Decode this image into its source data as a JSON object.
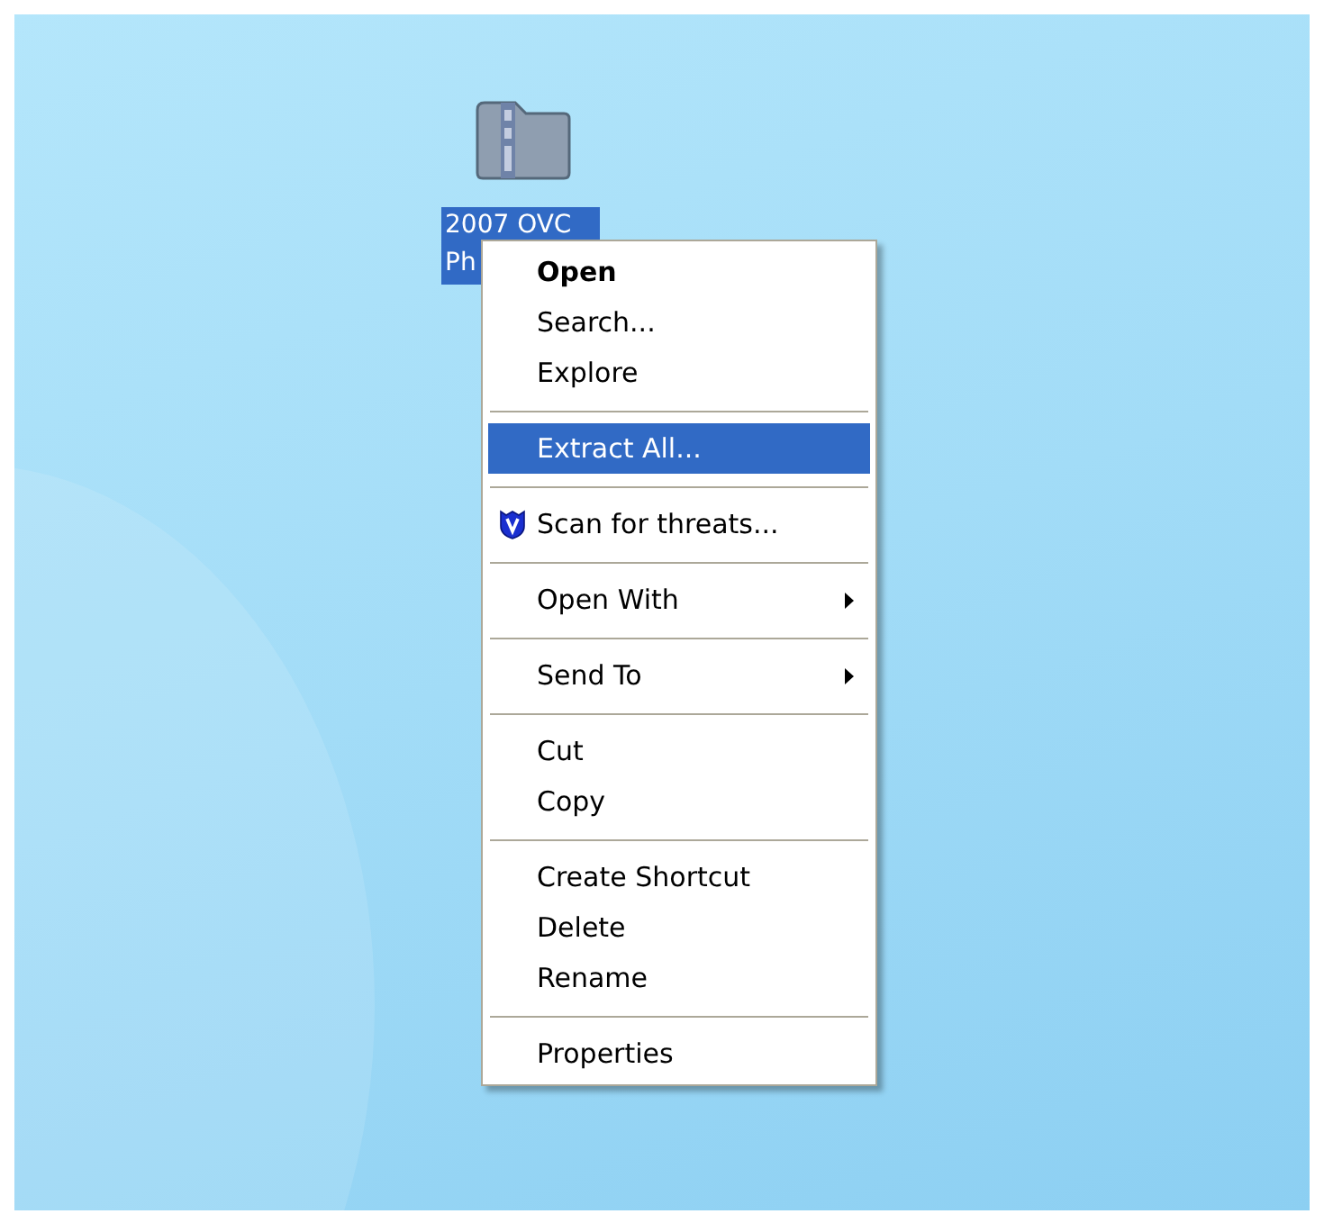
{
  "desktop_icon": {
    "label_lines": [
      "2007 OVC",
      "Ph"
    ],
    "selected": true
  },
  "context_menu": {
    "groups": [
      [
        {
          "label": "Open",
          "kind": "plain",
          "default": true,
          "submenu": false,
          "selected": false
        },
        {
          "label": "Search...",
          "kind": "plain",
          "default": false,
          "submenu": false,
          "selected": false
        },
        {
          "label": "Explore",
          "kind": "plain",
          "default": false,
          "submenu": false,
          "selected": false
        }
      ],
      [
        {
          "label": "Extract All...",
          "kind": "plain",
          "default": false,
          "submenu": false,
          "selected": true
        }
      ],
      [
        {
          "label": "Scan for threats...",
          "kind": "with-icon",
          "default": false,
          "submenu": false,
          "selected": false
        }
      ],
      [
        {
          "label": "Open With",
          "kind": "plain",
          "default": false,
          "submenu": true,
          "selected": false
        }
      ],
      [
        {
          "label": "Send To",
          "kind": "plain",
          "default": false,
          "submenu": true,
          "selected": false
        }
      ],
      [
        {
          "label": "Cut",
          "kind": "plain",
          "default": false,
          "submenu": false,
          "selected": false
        },
        {
          "label": "Copy",
          "kind": "plain",
          "default": false,
          "submenu": false,
          "selected": false
        }
      ],
      [
        {
          "label": "Create Shortcut",
          "kind": "plain",
          "default": false,
          "submenu": false,
          "selected": false
        },
        {
          "label": "Delete",
          "kind": "plain",
          "default": false,
          "submenu": false,
          "selected": false
        },
        {
          "label": "Rename",
          "kind": "plain",
          "default": false,
          "submenu": false,
          "selected": false
        }
      ],
      [
        {
          "label": "Properties",
          "kind": "plain",
          "default": false,
          "submenu": false,
          "selected": false
        }
      ]
    ]
  }
}
